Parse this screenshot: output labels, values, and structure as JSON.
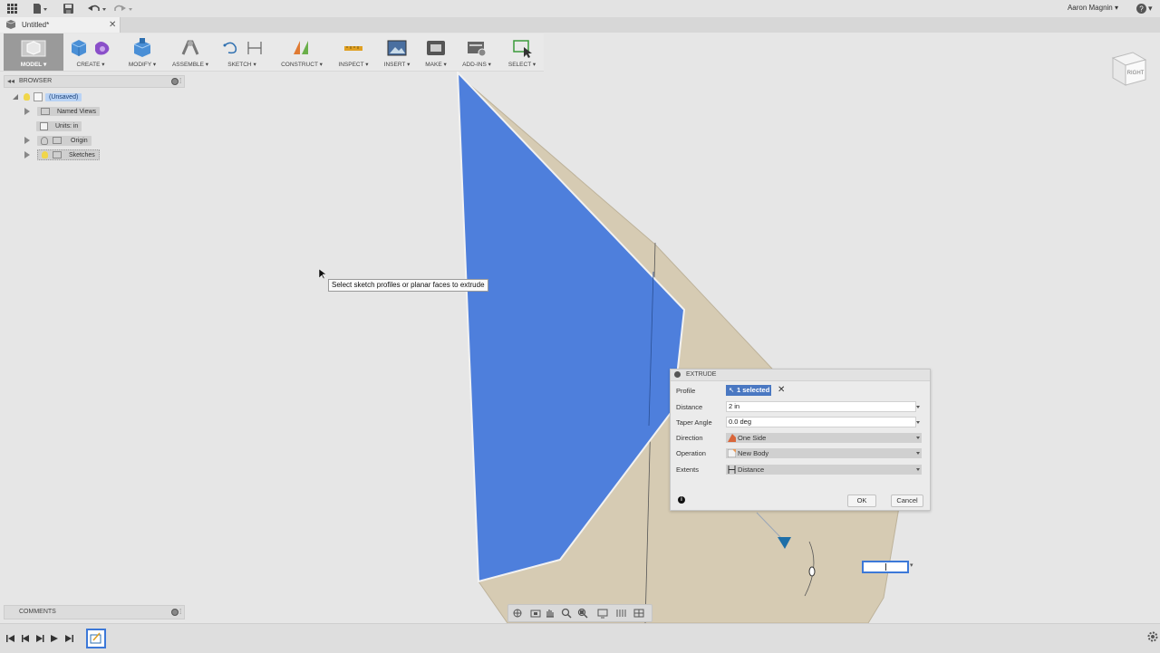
{
  "app": {
    "user_name": "Aaron Magnin",
    "help_label": "?"
  },
  "document": {
    "tab_title": "Untitled*"
  },
  "toolbar": {
    "items": [
      {
        "label": "MODEL"
      },
      {
        "label": "CREATE"
      },
      {
        "label": "MODIFY"
      },
      {
        "label": "ASSEMBLE"
      },
      {
        "label": "SKETCH"
      },
      {
        "label": "CONSTRUCT"
      },
      {
        "label": "INSPECT"
      },
      {
        "label": "INSERT"
      },
      {
        "label": "MAKE"
      },
      {
        "label": "ADD-INS"
      },
      {
        "label": "SELECT"
      }
    ]
  },
  "viewcube": {
    "face_label": "RIGHT"
  },
  "browser": {
    "title": "BROWSER",
    "items": [
      {
        "label": "(Unsaved)"
      },
      {
        "label": "Named Views"
      },
      {
        "label": "Units: in"
      },
      {
        "label": "Origin"
      },
      {
        "label": "Sketches"
      }
    ]
  },
  "comments": {
    "title": "COMMENTS"
  },
  "tooltip": {
    "text": "Select sketch profiles or planar faces to extrude"
  },
  "extrude": {
    "title": "EXTRUDE",
    "profile_label": "Profile",
    "profile_value": "1 selected",
    "distance_label": "Distance",
    "distance_value": "2 in",
    "taper_label": "Taper Angle",
    "taper_value": "0.0 deg",
    "direction_label": "Direction",
    "direction_value": "One Side",
    "operation_label": "Operation",
    "operation_value": "New Body",
    "extents_label": "Extents",
    "extents_value": "Distance",
    "ok_label": "OK",
    "cancel_label": "Cancel"
  },
  "colors": {
    "profile_fill": "#4e7fdc",
    "body_fill": "#d6cbb3",
    "accent": "#3c78d8"
  }
}
